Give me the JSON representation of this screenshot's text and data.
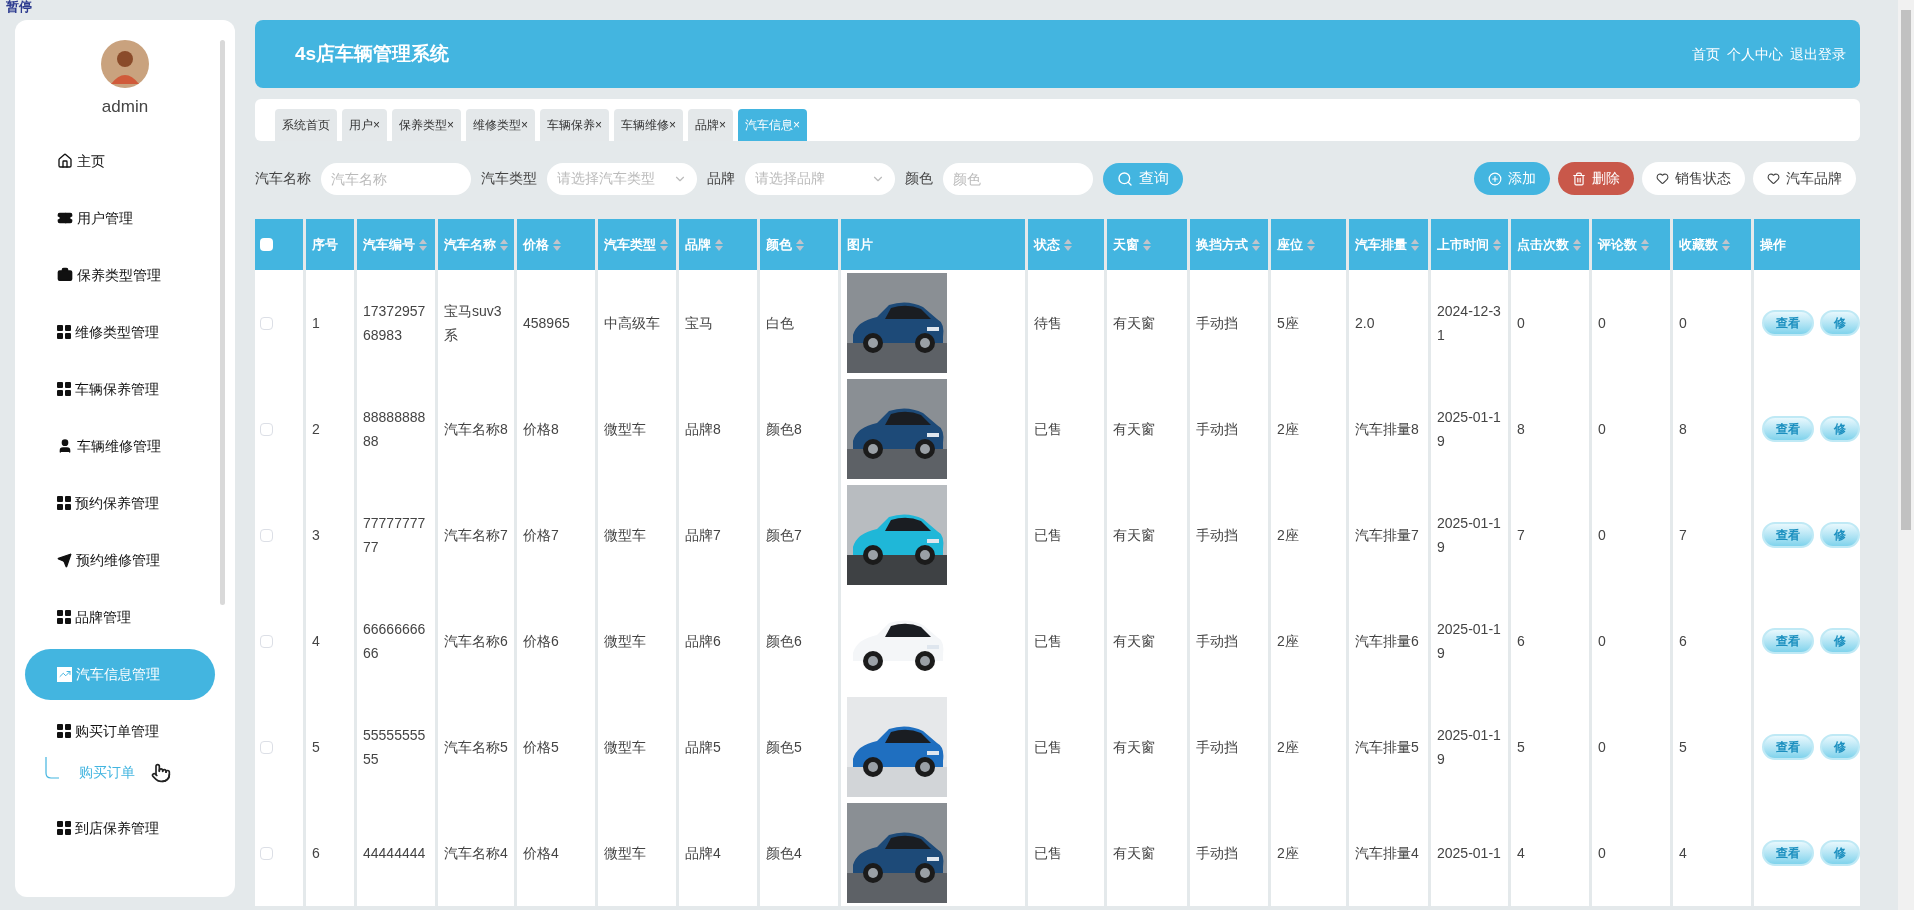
{
  "overlay_label": "暂停",
  "sidebar": {
    "user": {
      "name": "admin"
    },
    "items": [
      {
        "label": "主页",
        "kind": "home",
        "selected": false
      },
      {
        "label": "用户管理",
        "kind": "ticket",
        "selected": false
      },
      {
        "label": "保养类型管理",
        "kind": "briefcase",
        "selected": false
      },
      {
        "label": "维修类型管理",
        "kind": "grid",
        "selected": false
      },
      {
        "label": "车辆保养管理",
        "kind": "grid",
        "selected": false
      },
      {
        "label": "车辆维修管理",
        "kind": "user",
        "selected": false
      },
      {
        "label": "预约保养管理",
        "kind": "grid",
        "selected": false
      },
      {
        "label": "预约维修管理",
        "kind": "send",
        "selected": false
      },
      {
        "label": "品牌管理",
        "kind": "grid",
        "selected": false
      },
      {
        "label": "汽车信息管理",
        "kind": "chart",
        "selected": true
      },
      {
        "label": "购买订单管理",
        "kind": "grid",
        "selected": false,
        "expanded": true,
        "children": [
          {
            "label": "购买订单",
            "selected": false
          }
        ]
      },
      {
        "label": "到店保养管理",
        "kind": "grid",
        "selected": false
      }
    ]
  },
  "header": {
    "title": "4s店车辆管理系统",
    "links": [
      "首页",
      "个人中心",
      "退出登录"
    ]
  },
  "tabs": [
    {
      "label": "系统首页",
      "closable": false,
      "selected": false
    },
    {
      "label": "用户",
      "closable": true,
      "selected": false
    },
    {
      "label": "保养类型",
      "closable": true,
      "selected": false
    },
    {
      "label": "维修类型",
      "closable": true,
      "selected": false
    },
    {
      "label": "车辆保养",
      "closable": true,
      "selected": false
    },
    {
      "label": "车辆维修",
      "closable": true,
      "selected": false
    },
    {
      "label": "品牌",
      "closable": true,
      "selected": false
    },
    {
      "label": "汽车信息",
      "closable": true,
      "selected": true
    }
  ],
  "close_mark": "×",
  "search": {
    "fields": [
      {
        "label": "汽车名称",
        "placeholder": "汽车名称",
        "kind": "input"
      },
      {
        "label": "汽车类型",
        "placeholder": "请选择汽车类型",
        "kind": "select"
      },
      {
        "label": "品牌",
        "placeholder": "请选择品牌",
        "kind": "select"
      },
      {
        "label": "颜色",
        "placeholder": "颜色",
        "kind": "input"
      }
    ],
    "button": "查询"
  },
  "actions": [
    {
      "label": "添加",
      "kind": "primary"
    },
    {
      "label": "删除",
      "kind": "danger"
    },
    {
      "label": "销售状态",
      "kind": "plain"
    },
    {
      "label": "汽车品牌",
      "kind": "plain"
    }
  ],
  "table": {
    "select_all": {
      "checked": false
    },
    "columns": [
      {
        "label": "序号",
        "sortable": false
      },
      {
        "label": "汽车编号",
        "sortable": true
      },
      {
        "label": "汽车名称",
        "sortable": true
      },
      {
        "label": "价格",
        "sortable": true
      },
      {
        "label": "汽车类型",
        "sortable": true
      },
      {
        "label": "品牌",
        "sortable": true
      },
      {
        "label": "颜色",
        "sortable": true
      },
      {
        "label": "图片",
        "sortable": false
      },
      {
        "label": "状态",
        "sortable": true
      },
      {
        "label": "天窗",
        "sortable": true
      },
      {
        "label": "换挡方式",
        "sortable": true
      },
      {
        "label": "座位",
        "sortable": true
      },
      {
        "label": "汽车排量",
        "sortable": true
      },
      {
        "label": "上市时间",
        "sortable": true
      },
      {
        "label": "点击次数",
        "sortable": true
      },
      {
        "label": "评论数",
        "sortable": true
      },
      {
        "label": "收藏数",
        "sortable": true
      },
      {
        "label": "操作",
        "sortable": false,
        "kind": "actions"
      }
    ],
    "rows": [
      {
        "checked": false,
        "cells": [
          "1",
          "1737295768983",
          "宝马suv3系",
          "458965",
          "中高级车",
          "宝马",
          "白色",
          {
            "kind": "picture"
          },
          "待售",
          "有天窗",
          "手动挡",
          "5座",
          "2.0",
          "2024-12-31",
          "0",
          "0",
          "0",
          [
            "查看",
            "修"
          ]
        ]
      },
      {
        "checked": false,
        "cells": [
          "2",
          "8888888888",
          "汽车名称8",
          "价格8",
          "微型车",
          "品牌8",
          "颜色8",
          {
            "kind": "picture"
          },
          "已售",
          "有天窗",
          "手动挡",
          "2座",
          "汽车排量8",
          "2025-01-19",
          "8",
          "0",
          "8",
          [
            "查看",
            "修"
          ]
        ]
      },
      {
        "checked": false,
        "cells": [
          "3",
          "7777777777",
          "汽车名称7",
          "价格7",
          "微型车",
          "品牌7",
          "颜色7",
          {
            "kind": "picture"
          },
          "已售",
          "有天窗",
          "手动挡",
          "2座",
          "汽车排量7",
          "2025-01-19",
          "7",
          "0",
          "7",
          [
            "查看",
            "修"
          ]
        ]
      },
      {
        "checked": false,
        "cells": [
          "4",
          "6666666666",
          "汽车名称6",
          "价格6",
          "微型车",
          "品牌6",
          "颜色6",
          {
            "kind": "picture"
          },
          "已售",
          "有天窗",
          "手动挡",
          "2座",
          "汽车排量6",
          "2025-01-19",
          "6",
          "0",
          "6",
          [
            "查看",
            "修"
          ]
        ]
      },
      {
        "checked": false,
        "cells": [
          "5",
          "5555555555",
          "汽车名称5",
          "价格5",
          "微型车",
          "品牌5",
          "颜色5",
          {
            "kind": "picture"
          },
          "已售",
          "有天窗",
          "手动挡",
          "2座",
          "汽车排量5",
          "2025-01-19",
          "5",
          "0",
          "5",
          [
            "查看",
            "修"
          ]
        ]
      },
      {
        "checked": false,
        "cells": [
          "6",
          "44444444",
          "汽车名称4",
          "价格4",
          "微型车",
          "品牌4",
          "颜色4",
          {
            "kind": "picture"
          },
          "已售",
          "有天窗",
          "手动挡",
          "2座",
          "汽车排量4",
          "2025-01-1",
          "4",
          "0",
          "4",
          [
            "查看",
            "修"
          ]
        ]
      }
    ]
  }
}
